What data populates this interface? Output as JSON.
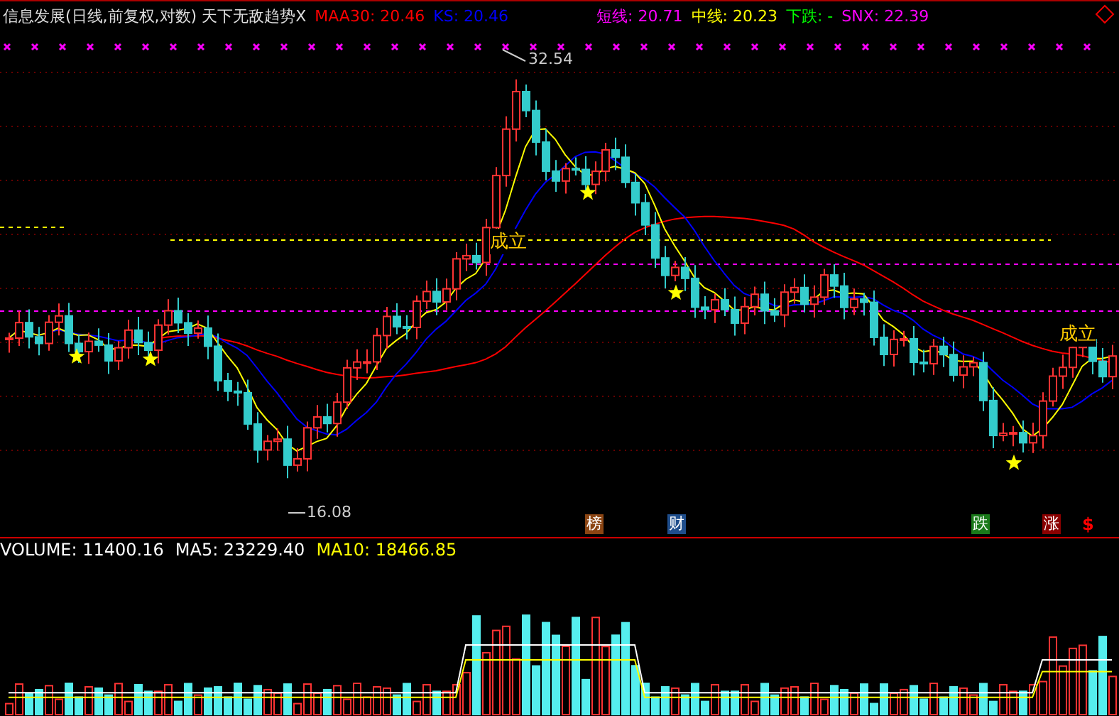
{
  "header": {
    "title": "信息发展(日线,前复权,对数) 天下无敌趋势X",
    "indicators": [
      {
        "label": "MAA30: 20.46",
        "color": "#ff0000"
      },
      {
        "label": "KS: 20.46",
        "color": "#0000ff"
      },
      {
        "label": "短线: 20.71",
        "color": "#ff00ff"
      },
      {
        "label": "中线: 20.23",
        "color": "#ffff00"
      },
      {
        "label": "下跌: -",
        "color": "#00ff00"
      },
      {
        "label": "SNX: 22.39",
        "color": "#ff00ff"
      }
    ]
  },
  "price_chart": {
    "high_label": "32.54",
    "low_label": "16.08",
    "signals": [
      {
        "text": "成立"
      },
      {
        "text": "成立"
      }
    ],
    "badges": [
      {
        "text": "榜",
        "color": "#8b4513"
      },
      {
        "text": "财",
        "color": "#1f4e8c"
      },
      {
        "text": "跌",
        "color": "#1a7a1a"
      },
      {
        "text": "涨",
        "color": "#8b0000"
      }
    ],
    "dollar_mark": "$"
  },
  "volume": {
    "indicators": [
      {
        "label": "VOLUME: 11400.16",
        "color": "#ffffff"
      },
      {
        "label": "MA5: 23229.40",
        "color": "#ffffff"
      },
      {
        "label": "MA10: 18466.85",
        "color": "#ffff00"
      }
    ]
  }
}
